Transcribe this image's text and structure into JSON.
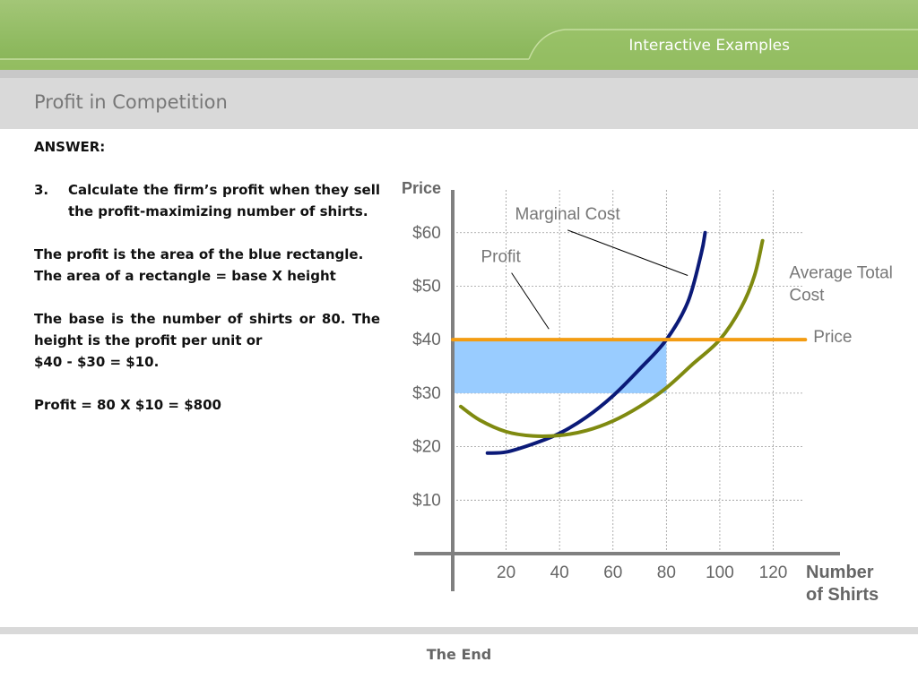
{
  "header": {
    "title": "Interactive Examples"
  },
  "slide": {
    "title": "Profit in Competition"
  },
  "content": {
    "answer_label": "ANSWER:",
    "question_number": "3.",
    "question_text": "Calculate the firm’s profit when they sell the profit-maximizing number of shirts.",
    "para1_line1": "The profit is the area of the blue rectangle.",
    "para1_line2": "The area of a rectangle = base X height",
    "para2_line1": "The base is the number of shirts or 80.  The height is the profit per unit or",
    "para2_line2": "$40 - $30 = $10.",
    "para3": "Profit = 80 X $10 = $800"
  },
  "chart_data": {
    "type": "line",
    "ylabel": "Price",
    "xlabel": "Number of Shirts",
    "xlabel_lines": [
      "Number",
      "of Shirts"
    ],
    "x_ticks": [
      20,
      40,
      60,
      80,
      100,
      120
    ],
    "y_ticks": [
      10,
      20,
      30,
      40,
      50,
      60
    ],
    "y_tick_labels": [
      "$10",
      "$20",
      "$30",
      "$40",
      "$50",
      "$60"
    ],
    "xlim": [
      0,
      145
    ],
    "ylim": [
      0,
      68
    ],
    "grid": true,
    "series": [
      {
        "name": "Marginal Cost",
        "color": "#0b1a78",
        "points": [
          [
            13,
            18.8
          ],
          [
            20,
            19
          ],
          [
            30,
            20.5
          ],
          [
            40,
            22.5
          ],
          [
            50,
            25.5
          ],
          [
            60,
            29.5
          ],
          [
            70,
            34.5
          ],
          [
            80,
            40
          ],
          [
            88,
            47
          ],
          [
            93,
            56
          ],
          [
            94.5,
            60
          ]
        ]
      },
      {
        "name": "Average Total Cost",
        "color": "#7f8a10",
        "points": [
          [
            3,
            27.5
          ],
          [
            10,
            25
          ],
          [
            20,
            22.8
          ],
          [
            30,
            22
          ],
          [
            40,
            22.1
          ],
          [
            50,
            23
          ],
          [
            60,
            24.8
          ],
          [
            70,
            27.5
          ],
          [
            80,
            31
          ],
          [
            90,
            35.5
          ],
          [
            100,
            40
          ],
          [
            108,
            46
          ],
          [
            113,
            52
          ],
          [
            116,
            58.5
          ]
        ]
      },
      {
        "name": "Price",
        "color": "#f39c12",
        "points": [
          [
            0,
            40
          ],
          [
            132,
            40
          ]
        ]
      }
    ],
    "profit_area": {
      "label": "Profit",
      "x": [
        0,
        80
      ],
      "y": [
        30,
        40
      ],
      "color": "#99ccff"
    },
    "annotations": [
      {
        "text": "Marginal Cost",
        "label_at": [
          43,
          62.5
        ],
        "points_to": [
          88,
          52
        ]
      },
      {
        "text": "Profit",
        "label_at": [
          18,
          54.5
        ],
        "points_to": [
          36,
          42
        ]
      },
      {
        "text": "Average Total Cost",
        "lines": [
          "Average Total",
          "Cost"
        ],
        "label_at": [
          126,
          51.5
        ]
      },
      {
        "text": "Price",
        "label_at": [
          135,
          39.5
        ]
      }
    ]
  },
  "footer": {
    "text": "The End"
  }
}
